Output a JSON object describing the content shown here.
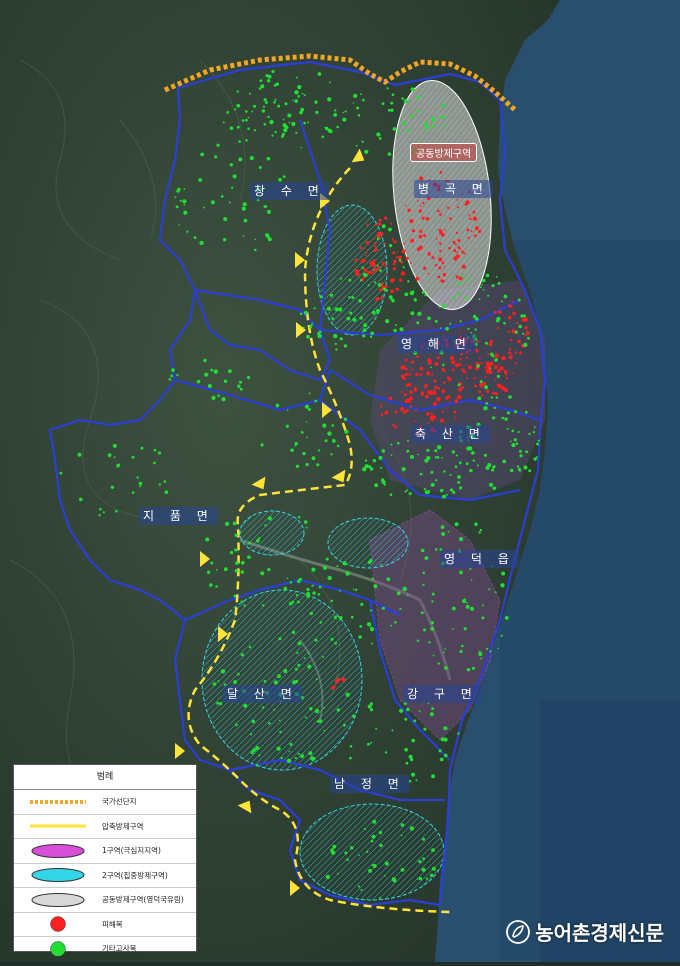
{
  "map": {
    "regions": [
      {
        "key": "changsu",
        "label": "창 수 면"
      },
      {
        "key": "byeonggok",
        "label": "병 곡 면"
      },
      {
        "key": "yeonghae",
        "label": "영 해 면"
      },
      {
        "key": "chuksan",
        "label": "축 산 면"
      },
      {
        "key": "jipum",
        "label": "지 품 면"
      },
      {
        "key": "yeongdeok",
        "label": "영 덕 읍"
      },
      {
        "key": "dalsan",
        "label": "달 산 면"
      },
      {
        "key": "ganggu",
        "label": "강 구 면"
      },
      {
        "key": "namjeong",
        "label": "남 정 면"
      }
    ],
    "zone_caption": "공동방제구역",
    "colors": {
      "boundary": "#2b3fd6",
      "national_park": "#f5a623",
      "compression_line": "#ffe23a",
      "zone1": "#d94fd9",
      "zone2": "#33d6e6",
      "joint_zone": "#d8d8d8",
      "damaged_tree": "#ff2020",
      "other_dead_tree": "#22dd33",
      "sea": "#2a4f6e"
    }
  },
  "legend": {
    "title": "범례",
    "items": [
      {
        "symbol": "dotted-line",
        "color": "#f5a623",
        "label": "국가선단지"
      },
      {
        "symbol": "solid-line",
        "color": "#ffe23a",
        "label": "압축방제구역"
      },
      {
        "symbol": "ellipse",
        "color": "#d94fd9",
        "label": "1구역(극심지지역)"
      },
      {
        "symbol": "ellipse",
        "color": "#33d6e6",
        "label": "2구역(집중방제구역)"
      },
      {
        "symbol": "ellipse",
        "color": "#d8d8d8",
        "label": "공동방제구역(영덕국유림)"
      },
      {
        "symbol": "circle",
        "color": "#ff2020",
        "label": "피해목"
      },
      {
        "symbol": "circle",
        "color": "#22dd33",
        "label": "기타고사목"
      }
    ]
  },
  "brand": {
    "name": "농어촌경제신문",
    "icon": "leaf-logo-icon"
  }
}
